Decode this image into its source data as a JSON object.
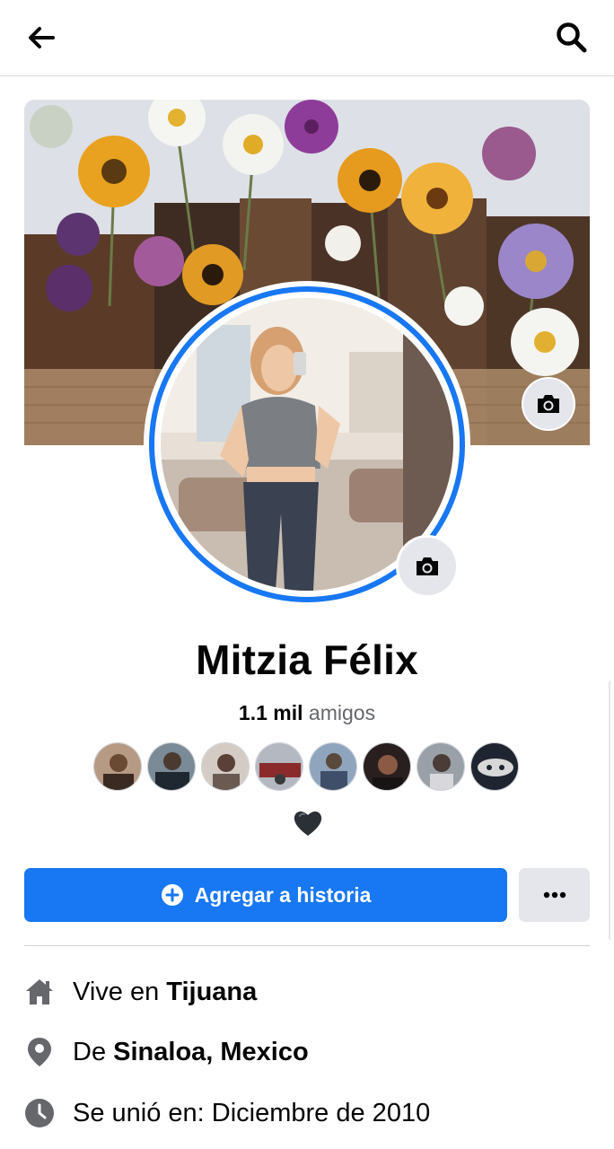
{
  "topbar": {
    "back_icon": "arrow-left-icon",
    "search_icon": "search-icon"
  },
  "cover": {
    "camera_icon": "camera-icon"
  },
  "profile": {
    "name": "Mitzia Félix",
    "friends_count": "1.1 mil",
    "friends_label": "amigos",
    "bio_emoji": "🖤",
    "avatar_camera_icon": "camera-icon"
  },
  "friend_avatars": [
    {
      "bg": "#7a5a3a"
    },
    {
      "bg": "#3b4a55"
    },
    {
      "bg": "#b89a8a"
    },
    {
      "bg": "#8b3a3a"
    },
    {
      "bg": "#5a6f8a"
    },
    {
      "bg": "#2a2020"
    },
    {
      "bg": "#6a7078"
    },
    {
      "bg": "#1e2430"
    }
  ],
  "actions": {
    "add_story_label": "Agregar a historia",
    "more_icon": "more-dots-icon"
  },
  "details": {
    "lives_prefix": "Vive en ",
    "lives_city": "Tijuana",
    "from_prefix": "De ",
    "from_place": "Sinaloa, Mexico",
    "joined": "Se unió en: Diciembre de 2010"
  },
  "colors": {
    "accent": "#1877f2",
    "secondary_text": "#65676b",
    "button_gray": "#e4e6eb"
  }
}
